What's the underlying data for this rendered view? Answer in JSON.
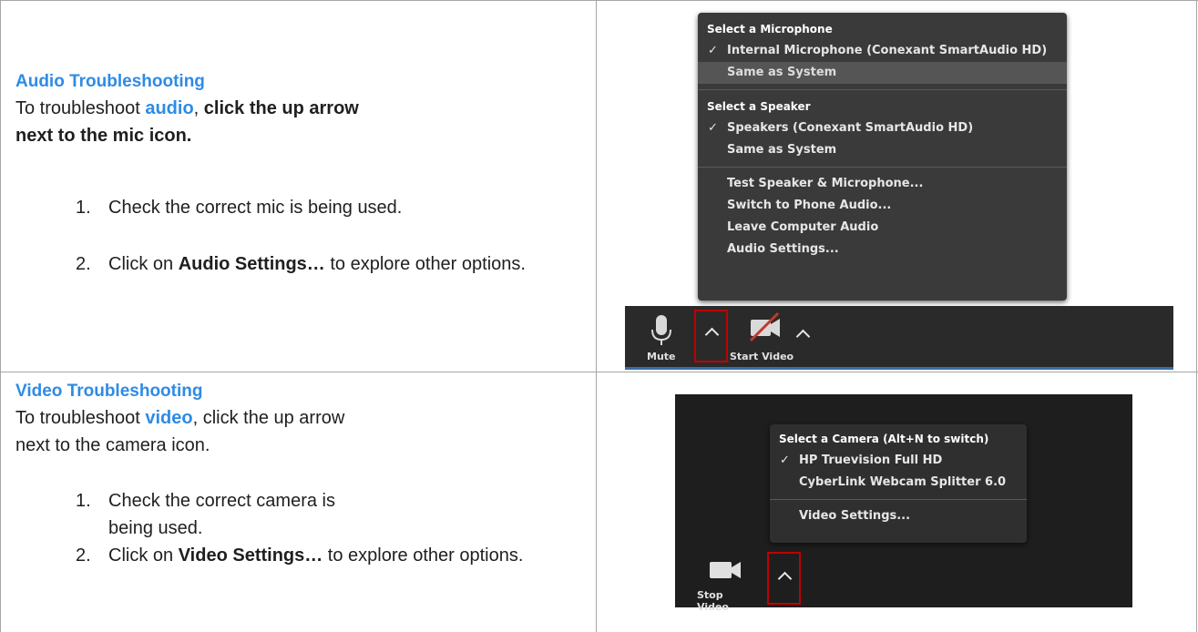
{
  "audio": {
    "heading": "Audio Troubleshooting",
    "intro_pre": "To troubleshoot ",
    "intro_keyword": "audio",
    "intro_comma": ", ",
    "intro_bold": "click the up arrow next to the mic icon.",
    "steps": [
      {
        "num": "1.",
        "pre": "Check the correct mic is being used.",
        "bold": "",
        "post": ""
      },
      {
        "num": "2.",
        "pre": "Click on ",
        "bold": "Audio Settings…",
        "post": " to explore other options."
      }
    ],
    "menu": {
      "mic_section": "Select a Microphone",
      "mic_items": [
        {
          "label": "Internal Microphone (Conexant SmartAudio HD)",
          "checked": true
        },
        {
          "label": "Same as System",
          "checked": false,
          "highlighted": true
        }
      ],
      "speaker_section": "Select a Speaker",
      "speaker_items": [
        {
          "label": "Speakers (Conexant SmartAudio HD)",
          "checked": true
        },
        {
          "label": "Same as System",
          "checked": false
        }
      ],
      "actions": [
        "Test Speaker & Microphone...",
        "Switch to Phone Audio...",
        "Leave Computer Audio",
        "Audio Settings..."
      ]
    },
    "toolbar": {
      "mute_label": "Mute",
      "video_label": "Start Video"
    }
  },
  "video": {
    "heading": "Video Troubleshooting",
    "intro_pre": "To troubleshoot ",
    "intro_keyword": "video",
    "intro_post": ", click the up arrow next to the camera icon.",
    "steps": [
      {
        "num": "1.",
        "pre": "Check the correct camera is being used.",
        "bold": "",
        "post": ""
      },
      {
        "num": "2.",
        "pre": "Click on ",
        "bold": "Video Settings…",
        "post": " to explore other options."
      }
    ],
    "menu": {
      "section": "Select a Camera (Alt+N to switch)",
      "items": [
        {
          "label": "HP Truevision Full HD",
          "checked": true
        },
        {
          "label": "CyberLink Webcam Splitter 6.0",
          "checked": false
        }
      ],
      "action": "Video Settings..."
    },
    "toolbar": {
      "video_label": "Stop Video"
    }
  },
  "colors": {
    "accent": "#2e8be6",
    "highlight": "#c00000",
    "panel": "#1e1e1e"
  }
}
